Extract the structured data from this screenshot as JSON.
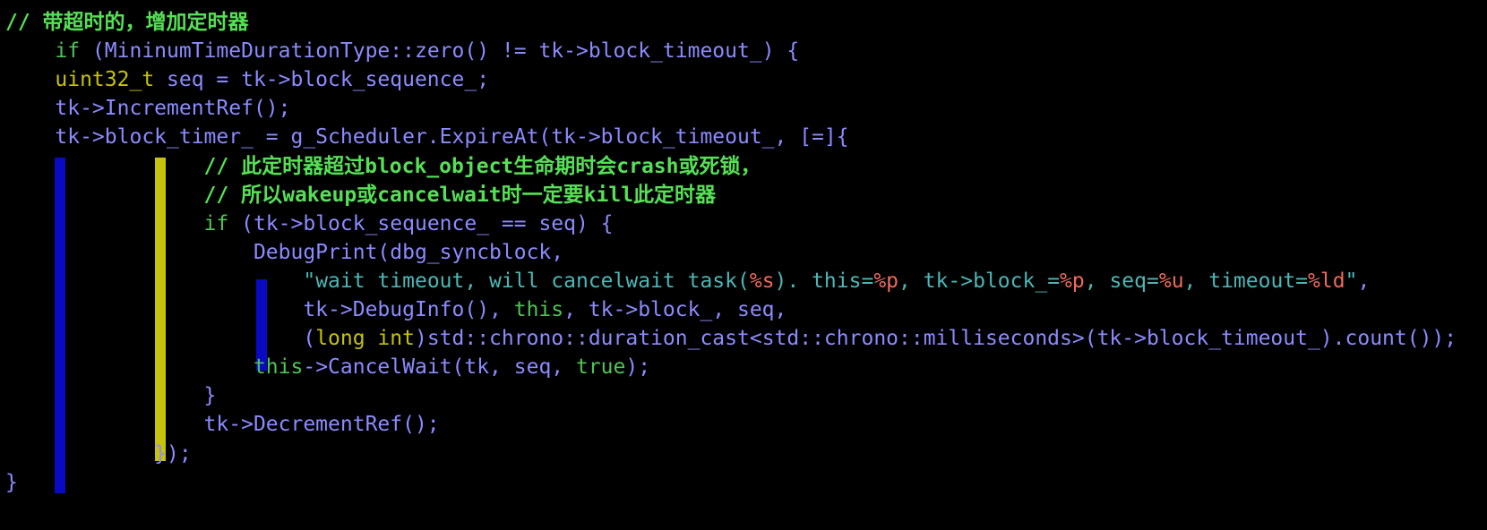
{
  "editor": {
    "background": "#000000",
    "colors": {
      "comment": "#55e055",
      "keyword": "#4fc453",
      "type": "#c7c20a",
      "identifier": "#8b8bff",
      "string": "#4db6b6",
      "format_specifier": "#ee6a5a",
      "indent_guide_blue": "#0a0ac4",
      "indent_guide_yellow": "#c7c20a"
    },
    "lines": [
      [
        {
          "t": "// 带超时的，增加定时器",
          "c": "comment"
        }
      ],
      [
        {
          "t": "    ",
          "c": "ident"
        },
        {
          "t": "if",
          "c": "keyword"
        },
        {
          "t": " (MininumTimeDurationType::zero() != tk->block_timeout_) {",
          "c": "ident"
        }
      ],
      [
        {
          "t": "    ",
          "c": "ident"
        },
        {
          "t": "uint32_t",
          "c": "type"
        },
        {
          "t": " seq = tk->block_sequence_;",
          "c": "ident"
        }
      ],
      [
        {
          "t": "    tk->IncrementRef();",
          "c": "ident"
        }
      ],
      [
        {
          "t": "    tk->block_timer_ = g_Scheduler.ExpireAt(tk->block_timeout_, [=]{",
          "c": "ident"
        }
      ],
      [
        {
          "t": "                // 此定时器超过block_object生命期时会crash或死锁，",
          "c": "comment"
        }
      ],
      [
        {
          "t": "                // 所以wakeup或cancelwait时一定要kill此定时器",
          "c": "comment"
        }
      ],
      [
        {
          "t": "                ",
          "c": "ident"
        },
        {
          "t": "if",
          "c": "keyword"
        },
        {
          "t": " (tk->block_sequence_ == seq) {",
          "c": "ident"
        }
      ],
      [
        {
          "t": "                    DebugPrint(dbg_syncblock,",
          "c": "ident"
        }
      ],
      [
        {
          "t": "                        ",
          "c": "ident"
        },
        {
          "t": "\"wait timeout, will cancelwait task(",
          "c": "string"
        },
        {
          "t": "%s",
          "c": "format"
        },
        {
          "t": "). this=",
          "c": "string"
        },
        {
          "t": "%p",
          "c": "format"
        },
        {
          "t": ", tk->block_=",
          "c": "string"
        },
        {
          "t": "%p",
          "c": "format"
        },
        {
          "t": ", seq=",
          "c": "string"
        },
        {
          "t": "%u",
          "c": "format"
        },
        {
          "t": ", timeout=",
          "c": "string"
        },
        {
          "t": "%ld",
          "c": "format"
        },
        {
          "t": "\"",
          "c": "string"
        },
        {
          "t": ",",
          "c": "ident"
        }
      ],
      [
        {
          "t": "                        tk->DebugInfo(), ",
          "c": "ident"
        },
        {
          "t": "this",
          "c": "keyword"
        },
        {
          "t": ", tk->block_, seq,",
          "c": "ident"
        }
      ],
      [
        {
          "t": "                        (",
          "c": "ident"
        },
        {
          "t": "long int",
          "c": "type"
        },
        {
          "t": ")std::chrono::duration_cast<std::chrono::milliseconds>(tk->block_timeout_).count());",
          "c": "ident"
        }
      ],
      [
        {
          "t": "                    ",
          "c": "ident"
        },
        {
          "t": "this",
          "c": "keyword"
        },
        {
          "t": "->CancelWait(tk, seq, ",
          "c": "ident"
        },
        {
          "t": "true",
          "c": "keyword"
        },
        {
          "t": ");",
          "c": "ident"
        }
      ],
      [
        {
          "t": "                }",
          "c": "ident"
        }
      ],
      [
        {
          "t": "                tk->DecrementRef();",
          "c": "ident"
        }
      ],
      [
        {
          "t": "            });",
          "c": "ident"
        }
      ],
      [
        {
          "t": "}",
          "c": "ident"
        }
      ]
    ]
  }
}
